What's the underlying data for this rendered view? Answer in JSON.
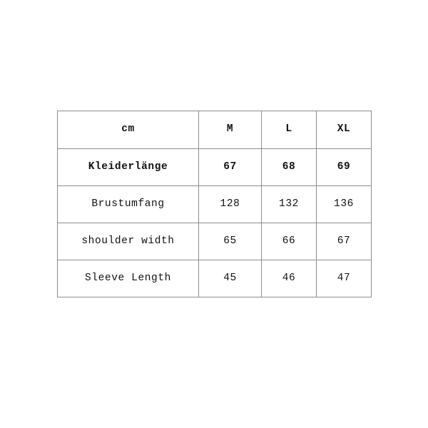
{
  "page": {
    "background_color": "#ffffff",
    "border_color": "#8c8c8c",
    "text_color": "#111111"
  },
  "size_chart": {
    "unit_label": "cm",
    "size_columns": [
      "M",
      "L",
      "XL"
    ],
    "rows": [
      {
        "label": "Kleiderlänge",
        "emphasis": true,
        "values": [
          "67",
          "68",
          "69"
        ]
      },
      {
        "label": "Brustumfang",
        "emphasis": false,
        "values": [
          "128",
          "132",
          "136"
        ]
      },
      {
        "label": "shoulder width",
        "emphasis": false,
        "values": [
          "65",
          "66",
          "67"
        ]
      },
      {
        "label": "Sleeve Length",
        "emphasis": false,
        "values": [
          "45",
          "46",
          "47"
        ]
      }
    ]
  },
  "chart_data": {
    "type": "table",
    "title": "",
    "unit": "cm",
    "columns": [
      "cm",
      "M",
      "L",
      "XL"
    ],
    "categories": [
      "Kleiderlänge",
      "Brustumfang",
      "shoulder width",
      "Sleeve Length"
    ],
    "series": [
      {
        "name": "M",
        "values": [
          67,
          128,
          65,
          45
        ]
      },
      {
        "name": "L",
        "values": [
          68,
          132,
          66,
          46
        ]
      },
      {
        "name": "XL",
        "values": [
          69,
          136,
          67,
          47
        ]
      }
    ],
    "rows": [
      {
        "label": "Kleiderlänge",
        "M": 67,
        "L": 68,
        "XL": 69
      },
      {
        "label": "Brustumfang",
        "M": 128,
        "L": 132,
        "XL": 136
      },
      {
        "label": "shoulder width",
        "M": 65,
        "L": 66,
        "XL": 67
      },
      {
        "label": "Sleeve Length",
        "M": 45,
        "L": 46,
        "XL": 47
      }
    ]
  }
}
